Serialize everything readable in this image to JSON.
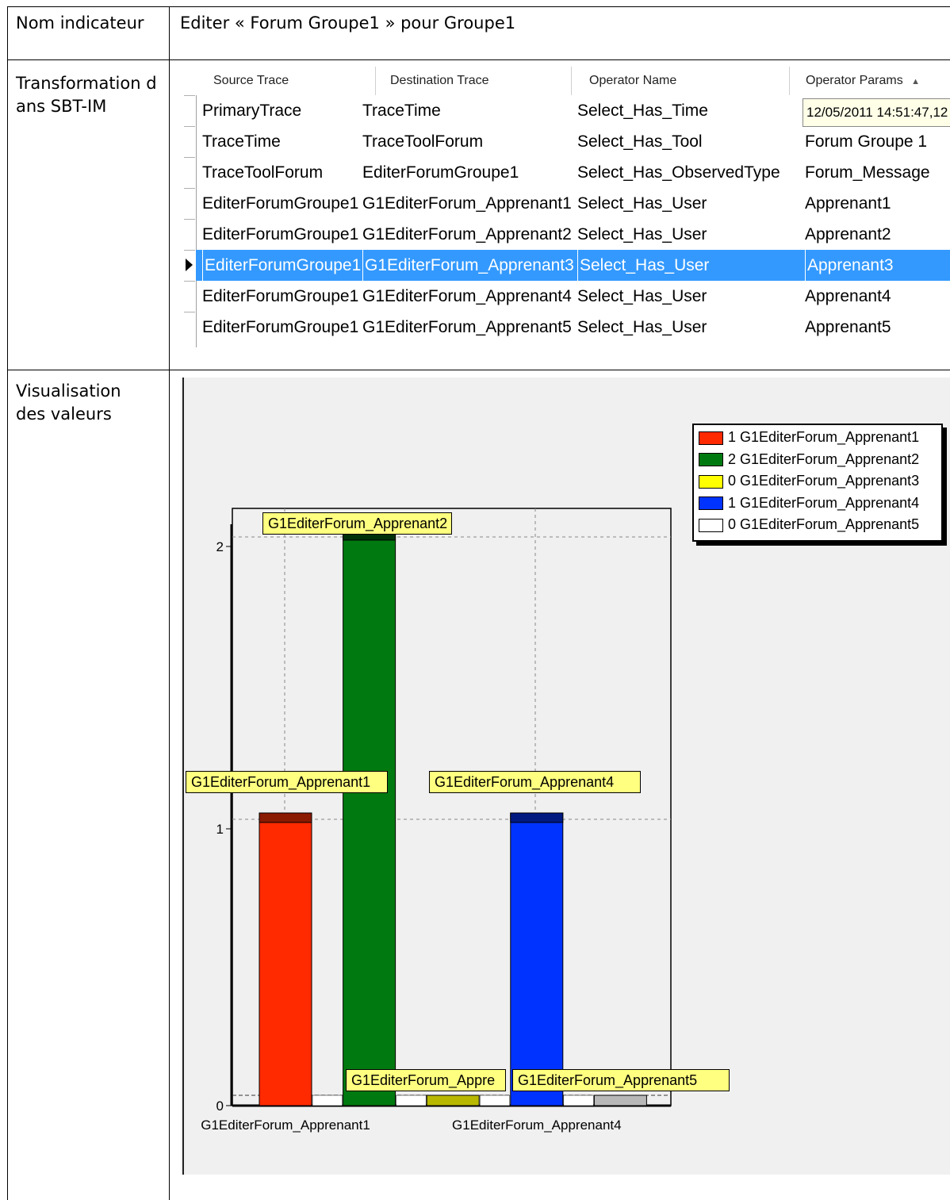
{
  "doc": {
    "row1_label": "Nom indicateur",
    "row1_value": "Editer « Forum Groupe1 » pour Groupe1",
    "row2_label": "Transformation dans SBT-IM",
    "row3_label": "Visualisation des valeurs"
  },
  "grid": {
    "columns": [
      "Source Trace",
      "Destination Trace",
      "Operator Name",
      "Operator Params"
    ],
    "sort_indicator": "▲",
    "selected_row": 5,
    "rows": [
      [
        "PrimaryTrace",
        "TraceTime",
        "Select_Has_Time",
        "12/05/2011 14:51:47,12"
      ],
      [
        "TraceTime",
        "TraceToolForum",
        "Select_Has_Tool",
        "Forum Groupe 1"
      ],
      [
        "TraceToolForum",
        "EditerForumGroupe1",
        "Select_Has_ObservedType",
        "Forum_Message"
      ],
      [
        "EditerForumGroupe1",
        "G1EditerForum_Apprenant1",
        "Select_Has_User",
        "Apprenant1"
      ],
      [
        "EditerForumGroupe1",
        "G1EditerForum_Apprenant2",
        "Select_Has_User",
        "Apprenant2"
      ],
      [
        "EditerForumGroupe1",
        "G1EditerForum_Apprenant3",
        "Select_Has_User",
        "Apprenant3"
      ],
      [
        "EditerForumGroupe1",
        "G1EditerForum_Apprenant4",
        "Select_Has_User",
        "Apprenant4"
      ],
      [
        "EditerForumGroupe1",
        "G1EditerForum_Apprenant5",
        "Select_Has_User",
        "Apprenant5"
      ]
    ]
  },
  "chart_data": {
    "type": "bar",
    "categories": [
      "G1EditerForum_Apprenant1",
      "G1EditerForum_Apprenant2",
      "G1EditerForum_Apprenant3",
      "G1EditerForum_Apprenant4",
      "G1EditerForum_Apprenant5"
    ],
    "values": [
      1,
      2,
      0,
      1,
      0
    ],
    "colors": [
      "#ff2a00",
      "#007a10",
      "#ffff00",
      "#0033ff",
      "#ffffff"
    ],
    "bar_labels": [
      "G1EditerForum_Apprenant1",
      "G1EditerForum_Apprenant2",
      "G1EditerForum_Appre",
      "G1EditerForum_Apprenant4",
      "G1EditerForum_Apprenant5"
    ],
    "x_tick_labels": [
      "G1EditerForum_Apprenant1",
      "",
      "",
      "G1EditerForum_Apprenant4",
      ""
    ],
    "y_ticks": [
      "0",
      "1",
      "2"
    ],
    "ylim": [
      0,
      2.1
    ],
    "grid": true,
    "legend_position": "top-right",
    "legend": [
      "1 G1EditerForum_Apprenant1",
      "2 G1EditerForum_Apprenant2",
      "0 G1EditerForum_Apprenant3",
      "1 G1EditerForum_Apprenant4",
      "0 G1EditerForum_Apprenant5"
    ],
    "title": "",
    "xlabel": "",
    "ylabel": ""
  }
}
